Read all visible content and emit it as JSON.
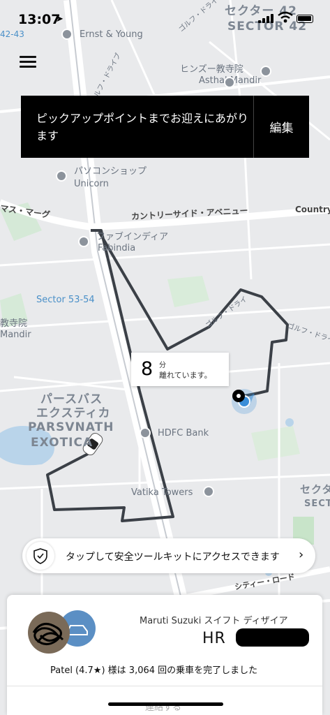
{
  "status_bar": {
    "time": "13:07",
    "location_arrow": "➤"
  },
  "map": {
    "labels": {
      "sector42_jp": "セクター 42",
      "sector42_en": "SECTOR 42",
      "station_42_43": "42-43",
      "ernst_young": "Ernst & Young",
      "golf_drive_top": "ゴルフ・ドライ",
      "golf_drive_left": "ルフ・ドライブ",
      "hindu_temple_jp": "ヒンズー教寺院",
      "hindu_temple_en": "Asthal Mandir",
      "pc_shop_jp": "パソコンショップ",
      "pc_shop_en": "Unicorn",
      "marg_left": "マス・マーグ",
      "countryside_avenue": "カントリーサイド・アベニュー",
      "country_right": "Country",
      "fabindia_jp": "ファブインディア",
      "fabindia_en": "Fabindia",
      "sector53_54": "Sector 53-54",
      "temple_left_jp": "教寺院",
      "temple_left_en": "Mandir",
      "golf_drive_right": "ゴルフ・ドライ",
      "golf_drive_mid": "ゴルフ・ドライ",
      "parsvnath_jp1": "パースバス",
      "parsvnath_jp2": "エクスティカ",
      "parsvnath_en1": "PARSVNATH",
      "parsvnath_en2": "EXOTICA",
      "hdfc_bank": "HDFC Bank",
      "vatika_towers": "Vatika Towers",
      "sector_right_jp": "セクタ",
      "sector_right_en": "SECT",
      "city_road": "シティー・ロード"
    }
  },
  "pickup_card": {
    "message": "ピックアップポイントまでお迎えにあがります",
    "edit_label": "編集"
  },
  "eta": {
    "value": "8",
    "unit": "分",
    "subtitle": "離れています。"
  },
  "safety": {
    "label": "タップして安全ツールキットにアクセスできます",
    "chevron": "›"
  },
  "trip": {
    "car_model": "Maruti Suzuki スイフト ディザイア",
    "plate": "HR",
    "driver_line": "Patel (4.7★) 様は 3,064 回の乗車を完了しました",
    "contact_label": "連絡する"
  },
  "colors": {
    "route": "#3b4047",
    "map_bg": "#e9eaec",
    "road": "#ffffff",
    "park": "#cfe8d2",
    "water": "#b9d4ea",
    "user_dot": "#3b8ed8"
  }
}
